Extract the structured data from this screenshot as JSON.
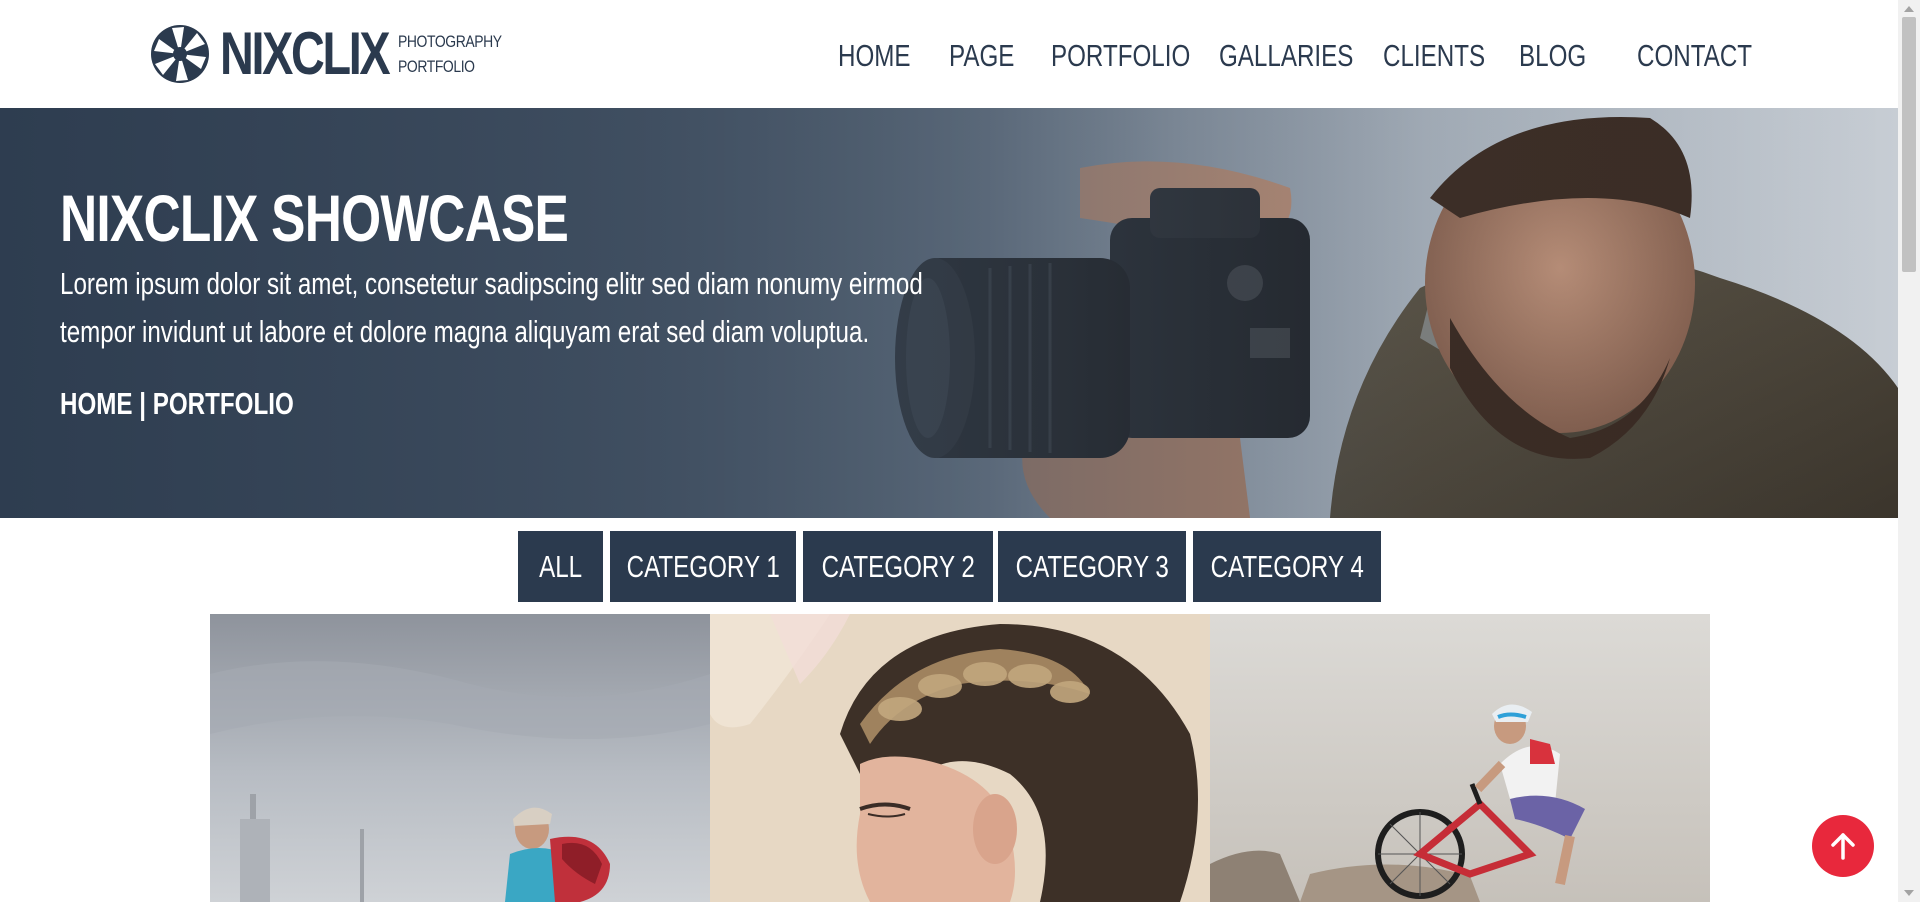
{
  "brand": {
    "name": "NIXCLIX",
    "tagline_line1": "PHOTOGRAPHY",
    "tagline_line2": "PORTFOLIO",
    "logo_icon": "aperture-icon"
  },
  "nav": {
    "items": [
      {
        "label": "HOME"
      },
      {
        "label": "PAGE"
      },
      {
        "label": "PORTFOLIO"
      },
      {
        "label": "GALLARIES"
      },
      {
        "label": "CLIENTS"
      },
      {
        "label": "BLOG"
      },
      {
        "label": "CONTACT"
      }
    ]
  },
  "hero": {
    "title": "NIXCLIX SHOWCASE",
    "text": "Lorem ipsum dolor sit amet, consetetur sadipscing elitr sed diam nonumy eirmod tempor invidunt ut labore et dolore magna aliquyam erat sed diam voluptua.",
    "breadcrumb": {
      "home": "HOME",
      "separator": " | ",
      "current": "PORTFOLIO"
    }
  },
  "filters": {
    "items": [
      {
        "label": "ALL"
      },
      {
        "label": "CATEGORY 1"
      },
      {
        "label": "CATEGORY 2"
      },
      {
        "label": "CATEGORY 3"
      },
      {
        "label": "CATEGORY 4"
      }
    ]
  },
  "gallery": {
    "items": [
      {
        "subject": "traveler with backpack"
      },
      {
        "subject": "woman with braided hair"
      },
      {
        "subject": "cyclist on mountain bike"
      }
    ]
  },
  "scroll_top": {
    "icon": "arrow-up-icon"
  },
  "colors": {
    "primary": "#2b3a4e",
    "accent": "#e8283c",
    "white": "#ffffff"
  }
}
